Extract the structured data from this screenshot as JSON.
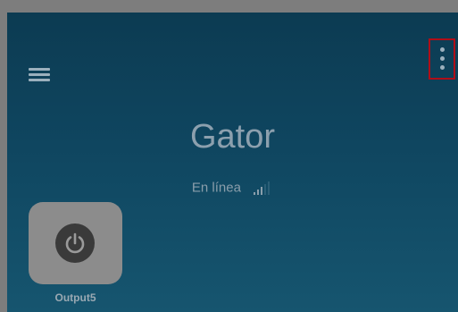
{
  "app": {
    "device_name": "Gator",
    "status_text": "En línea",
    "signal_level": 0.6
  },
  "toolbar": {
    "menu_icon": "hamburger-menu-icon",
    "more_icon": "more-vertical-icon"
  },
  "outputs": [
    {
      "label": "Output5",
      "icon": "power-icon"
    }
  ],
  "colors": {
    "background_top": "#0c3b52",
    "background_bottom": "#16556f",
    "highlight_border": "#b00e18",
    "tile": "#8c8c8c",
    "power_button": "#3a3a3a"
  }
}
